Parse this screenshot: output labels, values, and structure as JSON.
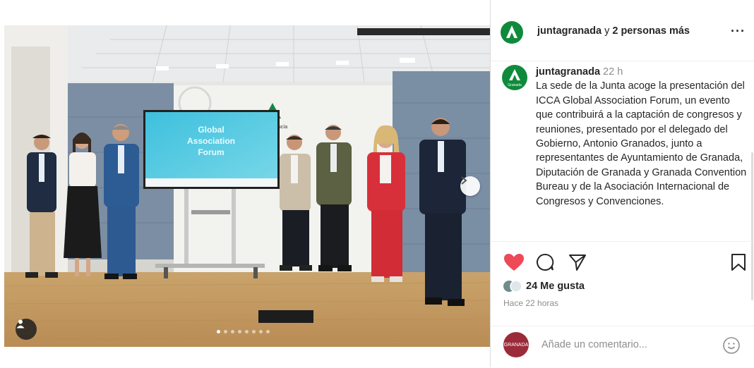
{
  "post": {
    "header": {
      "username": "juntagranada",
      "connector": "y",
      "others": "2 personas más",
      "menu_icon": "more-horizontal-icon"
    },
    "caption": {
      "username": "juntagranada",
      "time": "22 h",
      "text": "La sede de la Junta acoge la presentación del ICCA Global Association Forum, un evento que contribuirá a la captación de congresos y reuniones, presentado por el delegado del Gobierno, Antonio Granados, junto a representantes de Ayuntamiento de Granada, Diputación de Granada y Granada Convention Bureau y de la Asociación Internacional de Congresos y Convenciones."
    },
    "photo": {
      "screen_title_line1": "Global",
      "screen_title_line2": "Association",
      "screen_title_line3": "Forum",
      "banner_text": "Andalucía",
      "carousel_count": 8,
      "carousel_active": 1
    },
    "likes_label": "24 Me gusta",
    "posted_ago": "Hace 22 horas",
    "avatar_label": "Granada",
    "comment": {
      "placeholder": "Añade un comentario...",
      "avatar_label": "GRANADA"
    },
    "colors": {
      "like_red": "#ed4956",
      "brand_green": "#0f8a3c",
      "screen_blue": "#4ccbe0"
    }
  }
}
